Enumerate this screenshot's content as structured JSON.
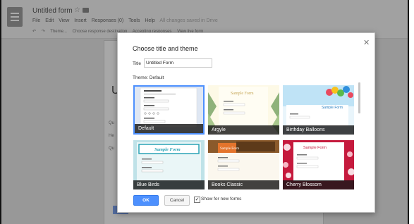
{
  "app": {
    "doc_title": "Untitled form",
    "menu": [
      "File",
      "Edit",
      "View",
      "Insert",
      "Responses (0)",
      "Tools",
      "Help"
    ],
    "save_status": "All changes saved in Drive",
    "toolbar": [
      "Theme...",
      "Choose response destination",
      "Accepting responses",
      "View live form"
    ],
    "bg_heading": "U"
  },
  "dialog": {
    "title": "Choose title and theme",
    "title_label": "Title",
    "title_value": "Untitled Form",
    "theme_label": "Theme: Default",
    "ok_label": "OK",
    "cancel_label": "Cancel",
    "checkbox_checked": true,
    "checkbox_label": "Show for new forms",
    "themes": [
      {
        "label": "Default",
        "selected": true,
        "colors": [
          "#ffffff",
          "#dfe7f3"
        ]
      },
      {
        "label": "Argyle",
        "selected": false,
        "colors": [
          "#fdf9e6",
          "#8fb27a"
        ],
        "sample_text": "Sample Form"
      },
      {
        "label": "Birthday Balloons",
        "selected": false,
        "colors": [
          "#e9f5fb",
          "#76c6f1"
        ],
        "sample_text": "Sample Form"
      },
      {
        "label": "Blue Birds",
        "selected": false,
        "colors": [
          "#eaf6f7",
          "#2aa3b6"
        ],
        "sample_text": "Sample Form"
      },
      {
        "label": "Books Classic",
        "selected": false,
        "colors": [
          "#fbf7ee",
          "#e4742c"
        ],
        "sample_text": "Sample Form"
      },
      {
        "label": "Cherry Blossom",
        "selected": false,
        "colors": [
          "#ffffff",
          "#c51a3d"
        ],
        "sample_text": "Sample Form"
      }
    ]
  }
}
